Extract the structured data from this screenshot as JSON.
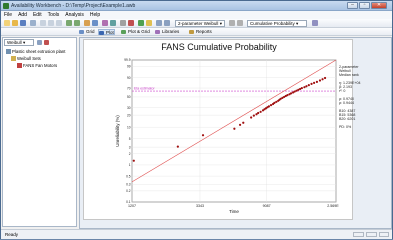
{
  "window": {
    "title": "Availability Workbench - D:\\Temp\\Project\\Example1.awb"
  },
  "menu": [
    "File",
    "Add",
    "Edit",
    "Tools",
    "Analysis",
    "Help"
  ],
  "toolbar": {
    "distribution_select": "2-parameter Weibull",
    "results_select": "Cumulative Probability"
  },
  "view_tabs": [
    "Grid",
    "Plot",
    "Plot & Grid",
    "Libraries",
    "Reports"
  ],
  "tree": {
    "filter_select": "Weibull",
    "root": "Plastic sheet extrusion plant",
    "child": "Weibull Sets",
    "leaf": "FANS Fan Motors"
  },
  "chart_data": {
    "type": "scatter",
    "title": "FANS Cumulative Probability",
    "xlabel": "Time",
    "ylabel": "Unreliability (%)",
    "scale": "weibull probability (log time axis)",
    "x_ticks": [
      "1207",
      "3343",
      "9087",
      "2.569E+04"
    ],
    "y_ticks": [
      "99.9",
      "99",
      "90",
      "70",
      "50",
      "30",
      "20",
      "10",
      "5",
      "3",
      "2",
      "1",
      "0.5",
      "0.3",
      "0.2",
      "0.1"
    ],
    "xlim": [
      1207,
      25690
    ],
    "ylim": [
      0.1,
      99.9
    ],
    "reference_line": {
      "label": "Eta estimator",
      "value": 63.2,
      "color": "#cc44cc"
    },
    "fit_line": {
      "color": "#e05050",
      "from": [
        1207,
        0.35
      ],
      "to": [
        25690,
        99.9
      ]
    },
    "series": [
      {
        "color": "#a01010",
        "points": [
          [
            1240,
            1.3
          ],
          [
            2400,
            3.1
          ],
          [
            3500,
            6.2
          ],
          [
            5600,
            9.1
          ],
          [
            6100,
            11.5
          ],
          [
            6400,
            13.0
          ],
          [
            7200,
            17.5
          ],
          [
            7500,
            19.5
          ],
          [
            7800,
            21.0
          ],
          [
            8000,
            22.5
          ],
          [
            8300,
            24.0
          ],
          [
            8600,
            26.0
          ],
          [
            8800,
            27.5
          ],
          [
            9000,
            29.0
          ],
          [
            9200,
            30.5
          ],
          [
            9400,
            32.0
          ],
          [
            9700,
            34.0
          ],
          [
            10000,
            36.0
          ],
          [
            10200,
            38.0
          ],
          [
            10500,
            40.0
          ],
          [
            10800,
            42.0
          ],
          [
            11000,
            44.0
          ],
          [
            11200,
            46.0
          ],
          [
            11500,
            48.0
          ],
          [
            11800,
            50.0
          ],
          [
            12100,
            52.0
          ],
          [
            12400,
            54.0
          ],
          [
            12800,
            56.0
          ],
          [
            13100,
            58.0
          ],
          [
            13500,
            60.0
          ],
          [
            13800,
            62.0
          ],
          [
            14200,
            64.0
          ],
          [
            14600,
            66.0
          ],
          [
            15000,
            68.0
          ],
          [
            15400,
            70.0
          ],
          [
            16000,
            72.0
          ],
          [
            16500,
            74.0
          ],
          [
            17100,
            76.5
          ],
          [
            17800,
            79.0
          ],
          [
            18500,
            81.0
          ],
          [
            19300,
            83.0
          ],
          [
            20200,
            85.5
          ],
          [
            21000,
            87.5
          ],
          [
            21800,
            89.5
          ]
        ]
      }
    ]
  },
  "legend": {
    "lines": [
      "2-parameter",
      "Weibull",
      "Median rank",
      "",
      "η: 1.239E+04",
      "β: 2.193",
      "r²: 0",
      "",
      "ρ: 0.9740",
      "ρ: 0.9444",
      "",
      "B10: 4387",
      "B15: 5368",
      "B20: 6201",
      "",
      "PD: 0%"
    ]
  },
  "status": {
    "text": "Ready"
  }
}
